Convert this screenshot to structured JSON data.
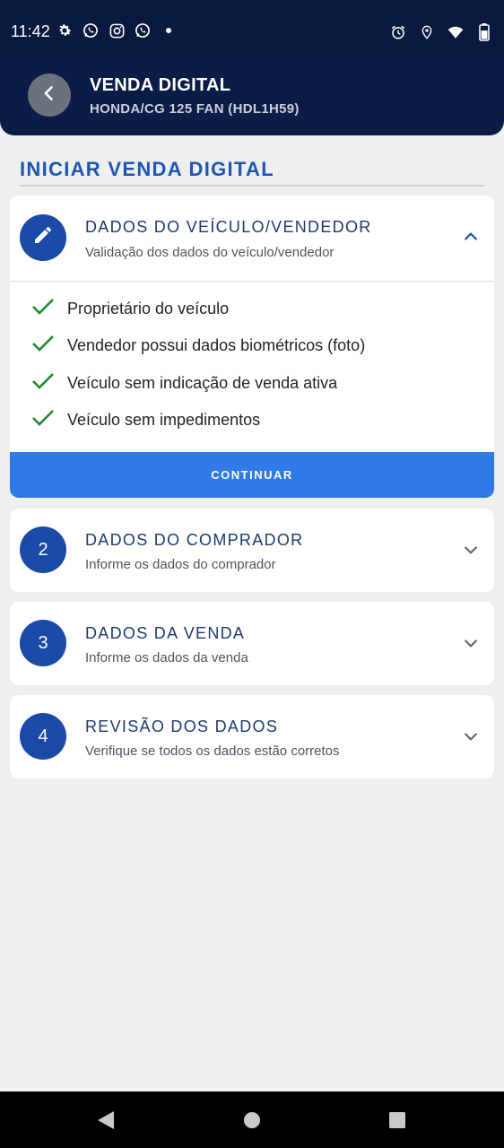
{
  "status_bar": {
    "time": "11:42",
    "left_icons": [
      "settings-icon",
      "whatsapp-icon",
      "instagram-icon",
      "whatsapp-icon",
      "dot-icon"
    ],
    "right_icons": [
      "alarm-icon",
      "location-icon",
      "wifi-icon",
      "battery-icon"
    ]
  },
  "header": {
    "title": "VENDA DIGITAL",
    "subtitle": "HONDA/CG 125 FAN (HDL1H59)"
  },
  "section_title": "INICIAR VENDA DIGITAL",
  "steps": [
    {
      "icon": "pencil-icon",
      "title": "DADOS DO VEÍCULO/VENDEDOR",
      "description": "Validação dos dados do veículo/vendedor",
      "expanded": true,
      "checks": [
        "Proprietário do veículo",
        "Vendedor possui dados biométricos (foto)",
        "Veículo sem indicação de venda ativa",
        "Veículo sem impedimentos"
      ],
      "button_label": "CONTINUAR"
    },
    {
      "number": "2",
      "title": "DADOS DO COMPRADOR",
      "description": "Informe os dados do comprador",
      "expanded": false
    },
    {
      "number": "3",
      "title": "DADOS DA VENDA",
      "description": "Informe os dados da venda",
      "expanded": false
    },
    {
      "number": "4",
      "title": "REVISÃO DOS DADOS",
      "description": "Verifique se todos os dados estão corretos",
      "expanded": false
    }
  ],
  "colors": {
    "status_bar": "#0a1a3e",
    "header": "#0b1c46",
    "accent_blue": "#1b49a8",
    "button_blue": "#2f7ae6",
    "check_green": "#1e8a2e",
    "background": "#eeeff1"
  }
}
